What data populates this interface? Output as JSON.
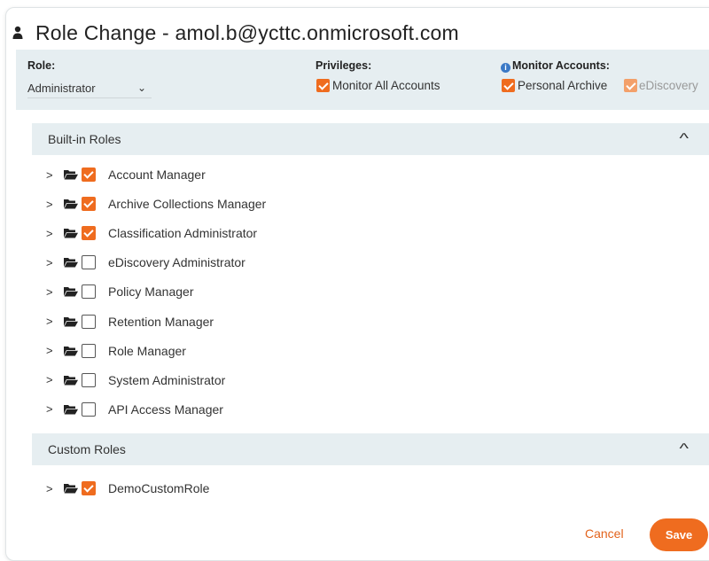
{
  "dialog": {
    "title": "Role Change - amol.b@ycttc.onmicrosoft.com"
  },
  "header_panel": {
    "role_label": "Role:",
    "role_value": "Administrator",
    "privileges_label": "Privileges:",
    "privileges": [
      {
        "label": "Monitor All Accounts",
        "checked": true
      }
    ],
    "monitor_label": "Monitor Accounts:",
    "monitor_options": [
      {
        "label": "Personal Archive",
        "checked": true
      },
      {
        "label": "eDiscovery",
        "checked": true
      }
    ]
  },
  "built_in_roles": {
    "title": "Built-in Roles",
    "items": [
      {
        "label": "Account Manager",
        "checked": true
      },
      {
        "label": "Archive Collections Manager",
        "checked": true
      },
      {
        "label": "Classification Administrator",
        "checked": true
      },
      {
        "label": "eDiscovery Administrator",
        "checked": false
      },
      {
        "label": "Policy Manager",
        "checked": false
      },
      {
        "label": "Retention Manager",
        "checked": false
      },
      {
        "label": "Role Manager",
        "checked": false
      },
      {
        "label": "System Administrator",
        "checked": false
      },
      {
        "label": "API Access Manager",
        "checked": false
      }
    ]
  },
  "custom_roles": {
    "title": "Custom Roles",
    "items": [
      {
        "label": "DemoCustomRole",
        "checked": true
      }
    ]
  },
  "footer": {
    "cancel_label": "Cancel",
    "save_label": "Save"
  },
  "colors": {
    "accent": "#ef6c1f",
    "panel_background": "#e6eef1",
    "info_blue": "#3a79c6"
  },
  "icons": {
    "title": "person-icon",
    "role_dropdown": "chevron-down-icon",
    "monitor_info": "info-icon",
    "row_expand": "chevron-right-icon",
    "row_folder": "folder-open-icon",
    "section_collapse": "chevron-up-icon"
  }
}
